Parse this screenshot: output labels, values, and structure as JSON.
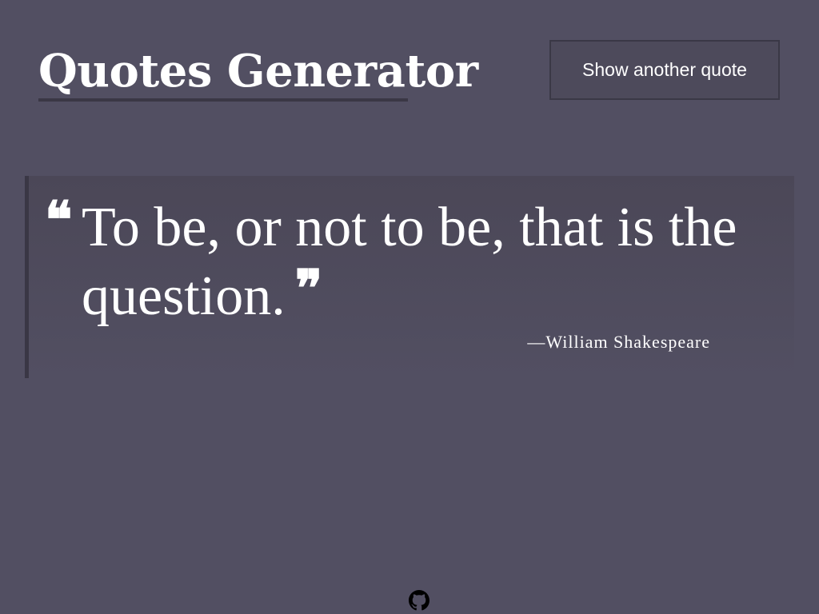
{
  "header": {
    "title": "Quotes Generator",
    "new_quote_button": "Show another quote"
  },
  "quote": {
    "open_mark": "❝",
    "text": "To be, or not to be, that is the question.",
    "close_mark": "❞",
    "author": "—William Shakespeare"
  },
  "footer": {
    "link_icon": "github-icon"
  },
  "colors": {
    "background": "#524f62",
    "button_background": "#4d4a5b",
    "accent_dark": "#3a3745",
    "text": "#ffffff"
  }
}
